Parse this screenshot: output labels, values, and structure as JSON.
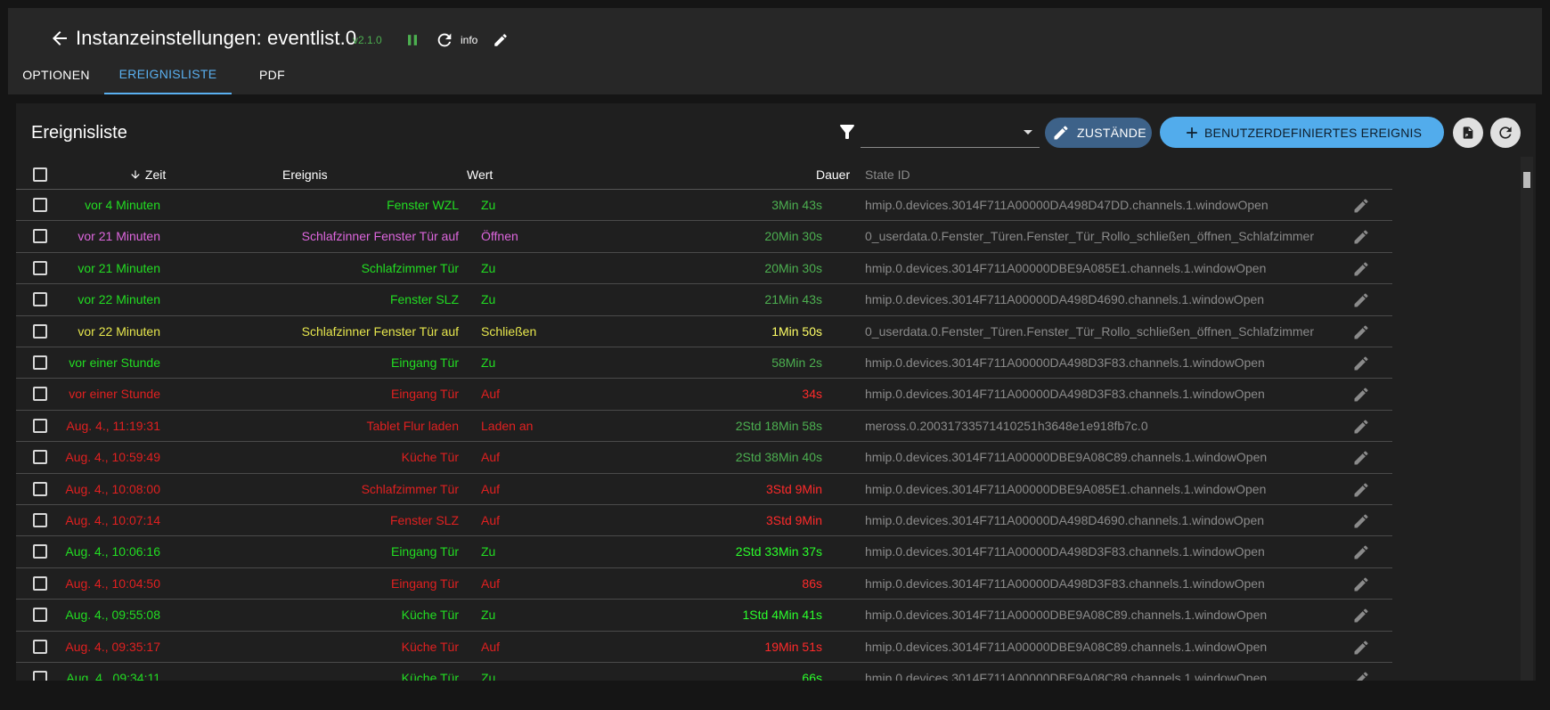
{
  "header": {
    "title": "Instanzeinstellungen: eventlist.0",
    "version": "v2.1.0",
    "info_label": "info"
  },
  "tabs": [
    {
      "label": "OPTIONEN",
      "active": false
    },
    {
      "label": "EREIGNISLISTE",
      "active": true
    },
    {
      "label": "PDF",
      "active": false
    }
  ],
  "card": {
    "title": "Ereignisliste",
    "filter_value": "",
    "states_button": "ZUSTÄNDE",
    "custom_event_button": "BENUTZERDEFINIERTES EREIGNIS"
  },
  "columns": {
    "time": "Zeit",
    "event": "Ereignis",
    "value": "Wert",
    "duration": "Dauer",
    "state_id": "State ID"
  },
  "colors": {
    "green": "#22dd22",
    "magenta": "#dd66dd",
    "yellow": "#e6e64d",
    "red": "#e02020",
    "dim_green": "#4caf50",
    "bright_yellow": "#ffff66",
    "bright_red": "#ff2a2a",
    "bright_green": "#2bff2b"
  },
  "rows": [
    {
      "time": "vor 4 Minuten",
      "event": "Fenster WZL",
      "value": "Zu",
      "duration": "3Min 43s",
      "state_id": "hmip.0.devices.3014F711A00000DA498D47DD.channels.1.windowOpen",
      "color": "#22dd22",
      "dur_color": "#4caf50"
    },
    {
      "time": "vor 21 Minuten",
      "event": "Schlafzinner Fenster Tür auf",
      "value": "Öffnen",
      "duration": "20Min 30s",
      "state_id": "0_userdata.0.Fenster_Türen.Fenster_Tür_Rollo_schließen_öffnen_Schlafzimmer",
      "color": "#dd66dd",
      "dur_color": "#4caf50"
    },
    {
      "time": "vor 21 Minuten",
      "event": "Schlafzimmer Tür",
      "value": "Zu",
      "duration": "20Min 30s",
      "state_id": "hmip.0.devices.3014F711A00000DBE9A085E1.channels.1.windowOpen",
      "color": "#22dd22",
      "dur_color": "#4caf50"
    },
    {
      "time": "vor 22 Minuten",
      "event": "Fenster SLZ",
      "value": "Zu",
      "duration": "21Min 43s",
      "state_id": "hmip.0.devices.3014F711A00000DA498D4690.channels.1.windowOpen",
      "color": "#22dd22",
      "dur_color": "#4caf50"
    },
    {
      "time": "vor 22 Minuten",
      "event": "Schlafzinner Fenster Tür auf",
      "value": "Schließen",
      "duration": "1Min 50s",
      "state_id": "0_userdata.0.Fenster_Türen.Fenster_Tür_Rollo_schließen_öffnen_Schlafzimmer",
      "color": "#e6e64d",
      "dur_color": "#ffff66"
    },
    {
      "time": "vor einer Stunde",
      "event": "Eingang Tür",
      "value": "Zu",
      "duration": "58Min 2s",
      "state_id": "hmip.0.devices.3014F711A00000DA498D3F83.channels.1.windowOpen",
      "color": "#22dd22",
      "dur_color": "#4caf50"
    },
    {
      "time": "vor einer Stunde",
      "event": "Eingang Tür",
      "value": "Auf",
      "duration": "34s",
      "state_id": "hmip.0.devices.3014F711A00000DA498D3F83.channels.1.windowOpen",
      "color": "#e02020",
      "dur_color": "#ff2a2a"
    },
    {
      "time": "Aug. 4., 11:19:31",
      "event": "Tablet Flur laden",
      "value": "Laden an",
      "duration": "2Std 18Min 58s",
      "state_id": "meross.0.20031733571410251h3648e1e918fb7c.0",
      "color": "#e02020",
      "dur_color": "#4caf50"
    },
    {
      "time": "Aug. 4., 10:59:49",
      "event": "Küche Tür",
      "value": "Auf",
      "duration": "2Std 38Min 40s",
      "state_id": "hmip.0.devices.3014F711A00000DBE9A08C89.channels.1.windowOpen",
      "color": "#e02020",
      "dur_color": "#4caf50"
    },
    {
      "time": "Aug. 4., 10:08:00",
      "event": "Schlafzimmer Tür",
      "value": "Auf",
      "duration": "3Std 9Min",
      "state_id": "hmip.0.devices.3014F711A00000DBE9A085E1.channels.1.windowOpen",
      "color": "#e02020",
      "dur_color": "#ff2a2a"
    },
    {
      "time": "Aug. 4., 10:07:14",
      "event": "Fenster SLZ",
      "value": "Auf",
      "duration": "3Std 9Min",
      "state_id": "hmip.0.devices.3014F711A00000DA498D4690.channels.1.windowOpen",
      "color": "#e02020",
      "dur_color": "#ff2a2a"
    },
    {
      "time": "Aug. 4., 10:06:16",
      "event": "Eingang Tür",
      "value": "Zu",
      "duration": "2Std 33Min 37s",
      "state_id": "hmip.0.devices.3014F711A00000DA498D3F83.channels.1.windowOpen",
      "color": "#22dd22",
      "dur_color": "#2bff2b"
    },
    {
      "time": "Aug. 4., 10:04:50",
      "event": "Eingang Tür",
      "value": "Auf",
      "duration": "86s",
      "state_id": "hmip.0.devices.3014F711A00000DA498D3F83.channels.1.windowOpen",
      "color": "#e02020",
      "dur_color": "#ff2a2a"
    },
    {
      "time": "Aug. 4., 09:55:08",
      "event": "Küche Tür",
      "value": "Zu",
      "duration": "1Std 4Min 41s",
      "state_id": "hmip.0.devices.3014F711A00000DBE9A08C89.channels.1.windowOpen",
      "color": "#22dd22",
      "dur_color": "#2bff2b"
    },
    {
      "time": "Aug. 4., 09:35:17",
      "event": "Küche Tür",
      "value": "Auf",
      "duration": "19Min 51s",
      "state_id": "hmip.0.devices.3014F711A00000DBE9A08C89.channels.1.windowOpen",
      "color": "#e02020",
      "dur_color": "#ff2a2a"
    },
    {
      "time": "Aug. 4., 09:34:11",
      "event": "Küche Tür",
      "value": "Zu",
      "duration": "66s",
      "state_id": "hmip.0.devices.3014F711A00000DBE9A08C89.channels.1.windowOpen",
      "color": "#22dd22",
      "dur_color": "#2bff2b"
    }
  ]
}
